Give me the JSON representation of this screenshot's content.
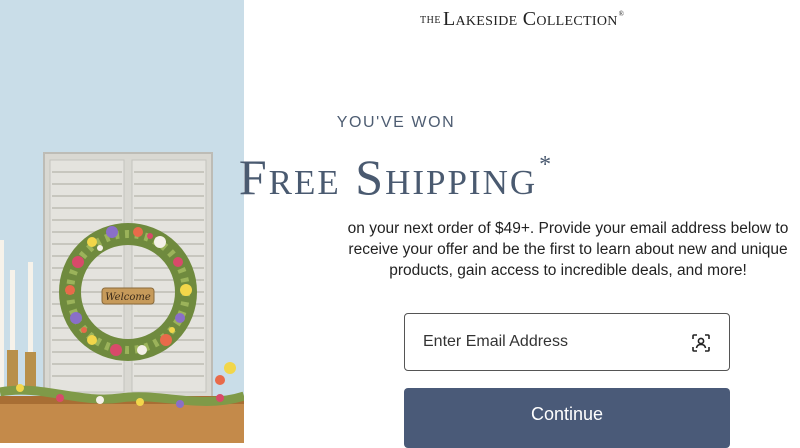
{
  "brand": {
    "the": "THE",
    "name": "Lakeside Collection",
    "registered": "®"
  },
  "offer": {
    "eyebrow": "YOU'VE WON",
    "headline": "Free Shipping",
    "asterisk": "*",
    "body": "on your next order of $49+. Provide your email address below to receive your offer and be the first to learn about new and unique products, gain access to incredible deals, and more!"
  },
  "form": {
    "email_placeholder": "Enter Email Address",
    "email_value": "",
    "autofill_icon": "contact-card-icon",
    "continue_label": "Continue"
  },
  "image": {
    "wreath_sign": "Welcome"
  },
  "colors": {
    "accent": "#4a5a78",
    "heading": "#4a5a70",
    "wall": "#c9dde8"
  }
}
